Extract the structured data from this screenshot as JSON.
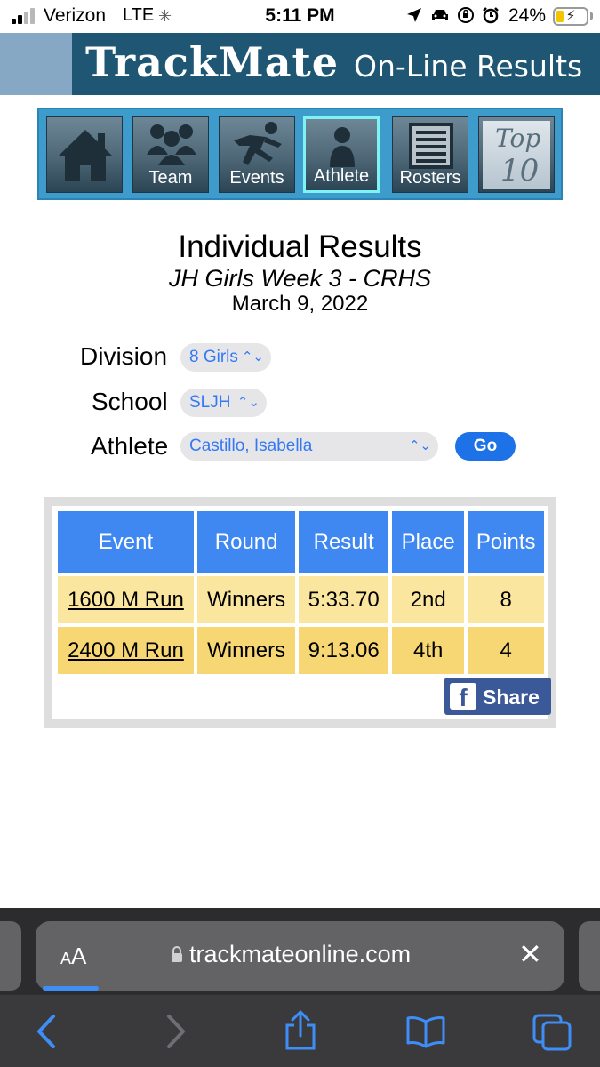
{
  "status_bar": {
    "carrier": "Verizon",
    "network": "LTE",
    "time": "5:11 PM",
    "battery_percent": "24%",
    "battery_level": 0.24,
    "battery_fill_color": "#f5c400",
    "icons": [
      "location-icon",
      "car-icon",
      "orientation-lock-icon",
      "alarm-icon",
      "charging-bolt-icon"
    ]
  },
  "banner": {
    "title": "TrackMate",
    "subtitle": "On-Line Results"
  },
  "nav": {
    "items": [
      {
        "label": "",
        "icon": "home-icon"
      },
      {
        "label": "Team",
        "icon": "team-icon"
      },
      {
        "label": "Events",
        "icon": "runner-icon"
      },
      {
        "label": "Athlete",
        "icon": "athlete-icon",
        "active": true
      },
      {
        "label": "Rosters",
        "icon": "roster-list-icon"
      },
      {
        "label": "",
        "icon": "top-10-icon",
        "text_a": "Top",
        "text_b": "10"
      }
    ],
    "background_color": "#3e9ccd",
    "active_border_color": "#7ff3f3"
  },
  "page": {
    "heading": "Individual Results",
    "meet_name": "JH Girls Week 3 - CRHS",
    "meet_date": "March 9, 2022"
  },
  "filters": {
    "division_label": "Division",
    "division_value": "8 Girls",
    "school_label": "School",
    "school_value": "SLJH",
    "athlete_label": "Athlete",
    "athlete_value": "Castillo, Isabella",
    "go_label": "Go"
  },
  "results": {
    "headers": [
      "Event",
      "Round",
      "Result",
      "Place",
      "Points"
    ],
    "rows": [
      {
        "event": "1600 M Run",
        "round": "Winners",
        "result": "5:33.70",
        "place": "2nd",
        "points": "8"
      },
      {
        "event": "2400 M Run",
        "round": "Winners",
        "result": "9:13.06",
        "place": "4th",
        "points": "4"
      }
    ],
    "header_color": "#3f88f2",
    "row_colors": [
      "#fbe6a0",
      "#f6d774"
    ],
    "share_label": "Share",
    "share_icon": "facebook-icon"
  },
  "browser": {
    "aa_label_small": "A",
    "aa_label_large": "A",
    "url": "trackmateonline.com",
    "toolbar_icons": [
      "back-icon",
      "forward-icon",
      "share-icon",
      "bookmarks-icon",
      "tabs-icon"
    ]
  }
}
